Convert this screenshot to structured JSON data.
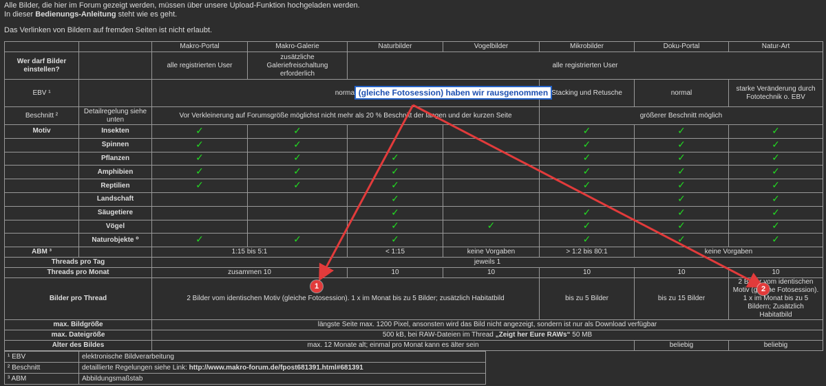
{
  "intro": {
    "line1": "Alle Bilder, die hier im Forum gezeigt werden, müssen über unsere Upload-Funktion hochgeladen werden.",
    "line2_pre": "In dieser ",
    "line2_link": "Bedienungs-Anleitung",
    "line2_post": " steht wie es geht.",
    "line3": "Das Verlinken von Bildern auf fremden Seiten ist nicht erlaubt."
  },
  "columns": [
    "Makro-Portal",
    "Makro-Galerie",
    "Naturbilder",
    "Vogelbilder",
    "Mikrobilder",
    "Doku-Portal",
    "Natur-Art"
  ],
  "rows": {
    "wer": {
      "label": "Wer darf Bilder einstellen?",
      "makro_portal": "alle registrierten User",
      "makro_galerie": "zusätzliche Galeriefreischaltung erforderlich",
      "rest": "alle registrierten User"
    },
    "ebv": {
      "label": "EBV ¹",
      "normal": "normal",
      "mikro": "Stacking und Retusche",
      "doku": "normal",
      "natur_art": "starke Veränderung durch Fototechnik o. EBV"
    },
    "beschnitt": {
      "label": "Beschnitt ²",
      "sub": "Detailregelung siehe unten",
      "left": "Vor Verkleinerung auf Forumsgröße möglichst nicht mehr als 20 % Beschnitt der langen und der kurzen Seite",
      "right": "größerer Beschnitt möglich"
    },
    "motiv_label": "Motiv",
    "motive": [
      {
        "name": "Insekten",
        "checks": [
          true,
          true,
          false,
          false,
          true,
          true,
          true
        ]
      },
      {
        "name": "Spinnen",
        "checks": [
          true,
          true,
          false,
          false,
          true,
          true,
          true
        ]
      },
      {
        "name": "Pflanzen",
        "checks": [
          true,
          true,
          true,
          false,
          true,
          true,
          true
        ]
      },
      {
        "name": "Amphibien",
        "checks": [
          true,
          true,
          true,
          false,
          true,
          true,
          true
        ]
      },
      {
        "name": "Reptilien",
        "checks": [
          true,
          true,
          true,
          false,
          true,
          true,
          true
        ]
      },
      {
        "name": "Landschaft",
        "checks": [
          false,
          false,
          true,
          false,
          false,
          true,
          true
        ]
      },
      {
        "name": "Säugetiere",
        "checks": [
          false,
          false,
          true,
          false,
          true,
          true,
          true
        ]
      },
      {
        "name": "Vögel",
        "checks": [
          false,
          false,
          true,
          true,
          true,
          true,
          true
        ]
      },
      {
        "name": "Naturobjekte ⁰",
        "checks": [
          true,
          true,
          true,
          false,
          true,
          true,
          true
        ]
      }
    ],
    "check_symbol": "✓",
    "abm": {
      "label": "ABM ³",
      "a": "1:15 bis 5:1",
      "b": "< 1:15",
      "c": "keine Vorgaben",
      "d": "> 1:2 bis 80:1",
      "e": "keine Vorgaben"
    },
    "tag": {
      "label": "Threads pro Tag",
      "val": "jeweils 1"
    },
    "monat": {
      "label": "Threads pro Monat",
      "a": "zusammen 10",
      "b": "10",
      "c": "10",
      "d": "10",
      "e": "10",
      "f": "10"
    },
    "bilder": {
      "label": "Bilder pro Thread",
      "a": "2 Bilder vom identischen Motiv (gleiche Fotosession). 1 x im Monat bis zu 5 Bilder; zusätzlich Habitatbild",
      "b": "bis zu 5 Bilder",
      "c": "bis zu 15 Bilder",
      "d": "2 Bilder vom identischen Motiv (gleiche Fotosession). 1 x im Monat bis zu 5 Bildern; Zusätzlich Habitatbild"
    },
    "bildgroesse": {
      "label": "max. Bildgröße",
      "val": "längste Seite max. 1200 Pixel, ansonsten wird das Bild nicht angezeigt, sondern ist nur als Download verfügbar"
    },
    "dateigroesse": {
      "label": "max. Dateigröße",
      "val_pre": "500 kB, bei RAW-Dateien im Thread ",
      "val_bold": "„Zeigt her Eure RAWs“",
      "val_post": " 50 MB"
    },
    "alter": {
      "label": "Alter des Bildes",
      "a": "max. 12 Monate alt; einmal pro Monat kann es älter sein",
      "b": "beliebig",
      "c": "beliebig"
    }
  },
  "footnotes": [
    {
      "key": "¹ EBV",
      "text": "elektronische Bildverarbeitung"
    },
    {
      "key": "² Beschnitt",
      "text_pre": "detaillierte Regelungen siehe Link: ",
      "link": "http://www.makro-forum.de/fpost681391.html#681391"
    },
    {
      "key": "³ ABM",
      "text": "Abbildungsmaßstab"
    }
  ],
  "annotation": {
    "callout": "(gleiche Fotosession) haben wir rausgenommen",
    "badge1": "1",
    "badge2": "2",
    "accent_color": "#e23b3b",
    "callout_border": "#2563c8"
  }
}
